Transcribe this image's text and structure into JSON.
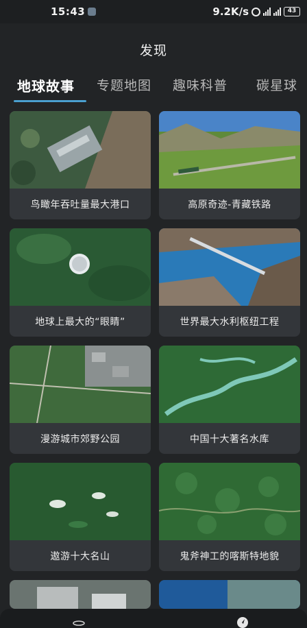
{
  "status_bar": {
    "time": "15:43",
    "speed": "9.2K/s",
    "battery": "43",
    "icons": [
      "app-icon",
      "alarm-icon",
      "signal-icon",
      "signal-icon",
      "battery-icon"
    ]
  },
  "header": {
    "title": "发现"
  },
  "tabs": [
    {
      "label": "地球故事",
      "active": true
    },
    {
      "label": "专题地图",
      "active": false
    },
    {
      "label": "趣味科普",
      "active": false
    },
    {
      "label": "碳星球",
      "active": false
    }
  ],
  "cards": [
    {
      "caption": "鸟瞰年吞吐量最大港口"
    },
    {
      "caption": "高原奇迹-青藏铁路"
    },
    {
      "caption": "地球上最大的“眼睛”"
    },
    {
      "caption": "世界最大水利枢纽工程"
    },
    {
      "caption": "漫游城市郊野公园"
    },
    {
      "caption": "中国十大著名水库"
    },
    {
      "caption": "遨游十大名山"
    },
    {
      "caption": "鬼斧神工的喀斯特地貌"
    }
  ],
  "bottom_nav": {
    "icons": [
      "planet-icon",
      "compass-icon"
    ]
  }
}
